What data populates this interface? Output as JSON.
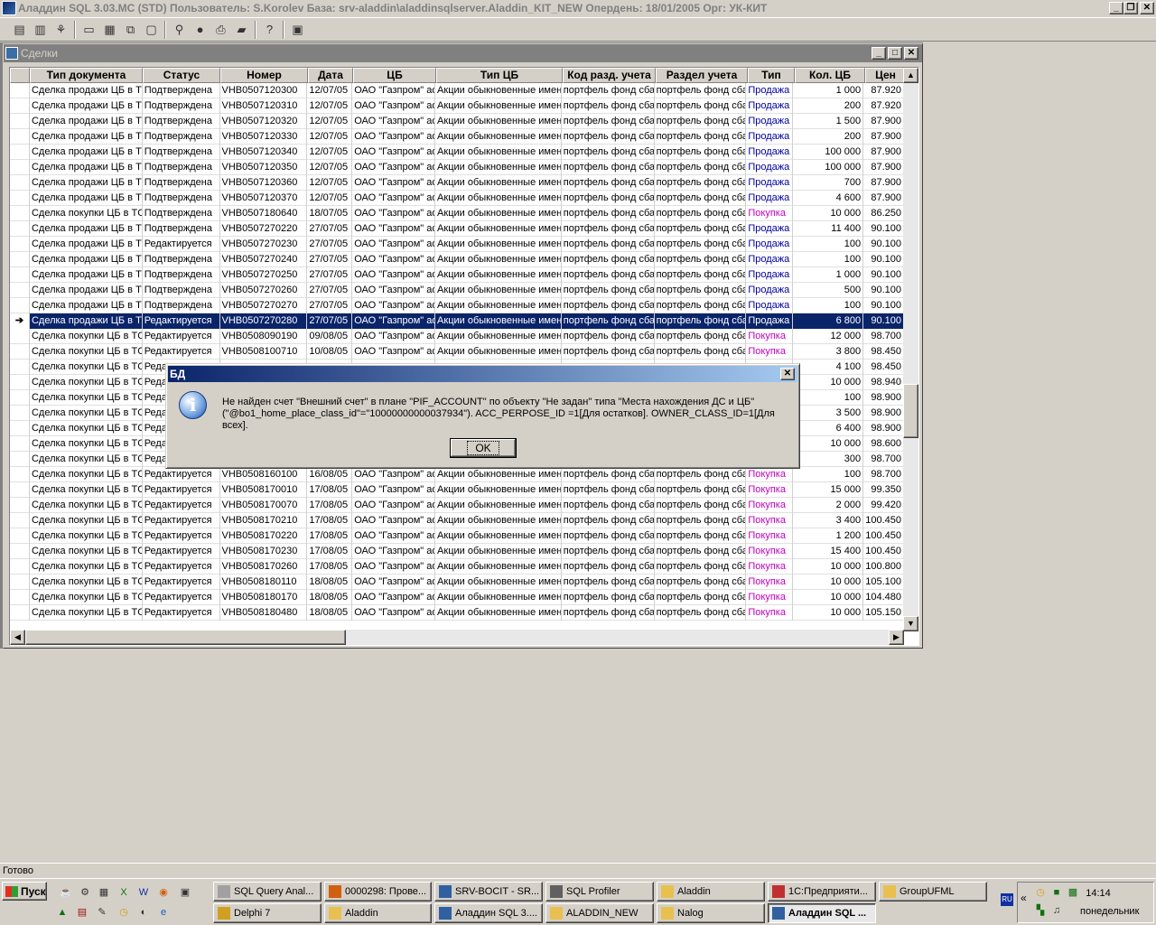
{
  "titlebar": {
    "title": "Аладдин SQL 3.03.MC (STD)  Пользователь: S.Korolev База: srv-aladdin\\aladdinsqlserver.Aladdin_KIT_NEW  Опердень: 18/01/2005  Орг: УК-КИТ"
  },
  "toolbar": {
    "icons": [
      "doc-icon",
      "clipboard-icon",
      "tree-icon",
      "window-icon",
      "tile-icon",
      "cascade-icon",
      "minimize-all-icon",
      "binoculars-icon",
      "stamp-icon",
      "print-icon",
      "folder-up-icon",
      "help-icon",
      "calculator-icon"
    ]
  },
  "child": {
    "title": "Сделки"
  },
  "grid": {
    "columns": [
      "Тип документа",
      "Статус",
      "Номер",
      "Дата",
      "ЦБ",
      "Тип ЦБ",
      "Код разд. учета",
      "Раздел учета",
      "Тип",
      "Кол. ЦБ",
      "Цен"
    ],
    "rows": [
      [
        "Сделка продажи ЦБ в ТП",
        "Подтверждена",
        "VHB0507120300",
        "12/07/05",
        "ОАО \"Газпром\" ао",
        "Акции обыкновенные именные",
        "портфель фонд сбал",
        "портфель фонд сбал",
        "Продажа",
        "1 000",
        "87.920"
      ],
      [
        "Сделка продажи ЦБ в ТП",
        "Подтверждена",
        "VHB0507120310",
        "12/07/05",
        "ОАО \"Газпром\" ао",
        "Акции обыкновенные именные",
        "портфель фонд сбал",
        "портфель фонд сбал",
        "Продажа",
        "200",
        "87.920"
      ],
      [
        "Сделка продажи ЦБ в ТП",
        "Подтверждена",
        "VHB0507120320",
        "12/07/05",
        "ОАО \"Газпром\" ао",
        "Акции обыкновенные именные",
        "портфель фонд сбал",
        "портфель фонд сбал",
        "Продажа",
        "1 500",
        "87.900"
      ],
      [
        "Сделка продажи ЦБ в ТП",
        "Подтверждена",
        "VHB0507120330",
        "12/07/05",
        "ОАО \"Газпром\" ао",
        "Акции обыкновенные именные",
        "портфель фонд сбал",
        "портфель фонд сбал",
        "Продажа",
        "200",
        "87.900"
      ],
      [
        "Сделка продажи ЦБ в ТП",
        "Подтверждена",
        "VHB0507120340",
        "12/07/05",
        "ОАО \"Газпром\" ао",
        "Акции обыкновенные именные",
        "портфель фонд сбал",
        "портфель фонд сбал",
        "Продажа",
        "100 000",
        "87.900"
      ],
      [
        "Сделка продажи ЦБ в ТП",
        "Подтверждена",
        "VHB0507120350",
        "12/07/05",
        "ОАО \"Газпром\" ао",
        "Акции обыкновенные именные",
        "портфель фонд сбал",
        "портфель фонд сбал",
        "Продажа",
        "100 000",
        "87.900"
      ],
      [
        "Сделка продажи ЦБ в ТП",
        "Подтверждена",
        "VHB0507120360",
        "12/07/05",
        "ОАО \"Газпром\" ао",
        "Акции обыкновенные именные",
        "портфель фонд сбал",
        "портфель фонд сбал",
        "Продажа",
        "700",
        "87.900"
      ],
      [
        "Сделка продажи ЦБ в ТП",
        "Подтверждена",
        "VHB0507120370",
        "12/07/05",
        "ОАО \"Газпром\" ао",
        "Акции обыкновенные именные",
        "портфель фонд сбал",
        "портфель фонд сбал",
        "Продажа",
        "4 600",
        "87.900"
      ],
      [
        "Сделка покупки ЦБ в ТС",
        "Подтверждена",
        "VHB0507180640",
        "18/07/05",
        "ОАО \"Газпром\" ао",
        "Акции обыкновенные именные",
        "портфель фонд сбал",
        "портфель фонд сбал",
        "Покупка",
        "10 000",
        "86.250"
      ],
      [
        "Сделка продажи ЦБ в ТП",
        "Подтверждена",
        "VHB0507270220",
        "27/07/05",
        "ОАО \"Газпром\" ао",
        "Акции обыкновенные именные",
        "портфель фонд сбал",
        "портфель фонд сбал",
        "Продажа",
        "11 400",
        "90.100"
      ],
      [
        "Сделка продажи ЦБ в ТП",
        "Редактируется",
        "VHB0507270230",
        "27/07/05",
        "ОАО \"Газпром\" ао",
        "Акции обыкновенные именные",
        "портфель фонд сбал",
        "портфель фонд сбал",
        "Продажа",
        "100",
        "90.100"
      ],
      [
        "Сделка продажи ЦБ в ТП",
        "Подтверждена",
        "VHB0507270240",
        "27/07/05",
        "ОАО \"Газпром\" ао",
        "Акции обыкновенные именные",
        "портфель фонд сбал",
        "портфель фонд сбал",
        "Продажа",
        "100",
        "90.100"
      ],
      [
        "Сделка продажи ЦБ в ТП",
        "Подтверждена",
        "VHB0507270250",
        "27/07/05",
        "ОАО \"Газпром\" ао",
        "Акции обыкновенные именные",
        "портфель фонд сбал",
        "портфель фонд сбал",
        "Продажа",
        "1 000",
        "90.100"
      ],
      [
        "Сделка продажи ЦБ в ТП",
        "Подтверждена",
        "VHB0507270260",
        "27/07/05",
        "ОАО \"Газпром\" ао",
        "Акции обыкновенные именные",
        "портфель фонд сбал",
        "портфель фонд сбал",
        "Продажа",
        "500",
        "90.100"
      ],
      [
        "Сделка продажи ЦБ в ТП",
        "Подтверждена",
        "VHB0507270270",
        "27/07/05",
        "ОАО \"Газпром\" ао",
        "Акции обыкновенные именные",
        "портфель фонд сбал",
        "портфель фонд сбал",
        "Продажа",
        "100",
        "90.100"
      ],
      [
        "Сделка продажи ЦБ в ТП",
        "Редактируется",
        "VHB0507270280",
        "27/07/05",
        "ОАО \"Газпром\" ао",
        "Акции обыкновенные именные",
        "портфель фонд сбал",
        "портфель фонд сбал",
        "Продажа",
        "6 800",
        "90.100"
      ],
      [
        "Сделка покупки ЦБ в ТС",
        "Редактируется",
        "VHB0508090190",
        "09/08/05",
        "ОАО \"Газпром\" ао",
        "Акции обыкновенные именные",
        "портфель фонд сбал",
        "портфель фонд сбал",
        "Покупка",
        "12 000",
        "98.700"
      ],
      [
        "Сделка покупки ЦБ в ТС",
        "Редактируется",
        "VHB0508100710",
        "10/08/05",
        "ОАО \"Газпром\" ао",
        "Акции обыкновенные именные",
        "портфель фонд сбал",
        "портфель фонд сбал",
        "Покупка",
        "3 800",
        "98.450"
      ],
      [
        "Сделка покупки ЦБ в ТС",
        "Редактируется",
        "",
        "",
        "",
        "",
        "",
        "",
        "",
        "4 100",
        "98.450"
      ],
      [
        "Сделка покупки ЦБ в ТС",
        "Редактируется",
        "",
        "",
        "",
        "",
        "",
        "",
        "",
        "10 000",
        "98.940"
      ],
      [
        "Сделка покупки ЦБ в ТС",
        "Редактируется",
        "",
        "",
        "",
        "",
        "",
        "",
        "",
        "100",
        "98.900"
      ],
      [
        "Сделка покупки ЦБ в ТС",
        "Редактируется",
        "",
        "",
        "",
        "",
        "",
        "",
        "",
        "3 500",
        "98.900"
      ],
      [
        "Сделка покупки ЦБ в ТС",
        "Редактируется",
        "",
        "",
        "",
        "",
        "",
        "",
        "",
        "6 400",
        "98.900"
      ],
      [
        "Сделка покупки ЦБ в ТС",
        "Редактируется",
        "",
        "",
        "",
        "",
        "",
        "",
        "",
        "10 000",
        "98.600"
      ],
      [
        "Сделка покупки ЦБ в ТС",
        "Редактируется",
        "",
        "",
        "",
        "",
        "",
        "",
        "",
        "300",
        "98.700"
      ],
      [
        "Сделка покупки ЦБ в ТС",
        "Редактируется",
        "VHB0508160100",
        "16/08/05",
        "ОАО \"Газпром\" ао",
        "Акции обыкновенные именные",
        "портфель фонд сбал",
        "портфель фонд сбал",
        "Покупка",
        "100",
        "98.700"
      ],
      [
        "Сделка покупки ЦБ в ТС",
        "Редактируется",
        "VHB0508170010",
        "17/08/05",
        "ОАО \"Газпром\" ао",
        "Акции обыкновенные именные",
        "портфель фонд сбал",
        "портфель фонд сбал",
        "Покупка",
        "15 000",
        "99.350"
      ],
      [
        "Сделка покупки ЦБ в ТС",
        "Редактируется",
        "VHB0508170070",
        "17/08/05",
        "ОАО \"Газпром\" ао",
        "Акции обыкновенные именные",
        "портфель фонд сбал",
        "портфель фонд сбал",
        "Покупка",
        "2 000",
        "99.420"
      ],
      [
        "Сделка покупки ЦБ в ТС",
        "Редактируется",
        "VHB0508170210",
        "17/08/05",
        "ОАО \"Газпром\" ао",
        "Акции обыкновенные именные",
        "портфель фонд сбал",
        "портфель фонд сбал",
        "Покупка",
        "3 400",
        "100.450"
      ],
      [
        "Сделка покупки ЦБ в ТС",
        "Редактируется",
        "VHB0508170220",
        "17/08/05",
        "ОАО \"Газпром\" ао",
        "Акции обыкновенные именные",
        "портфель фонд сбал",
        "портфель фонд сбал",
        "Покупка",
        "1 200",
        "100.450"
      ],
      [
        "Сделка покупки ЦБ в ТС",
        "Редактируется",
        "VHB0508170230",
        "17/08/05",
        "ОАО \"Газпром\" ао",
        "Акции обыкновенные именные",
        "портфель фонд сбал",
        "портфель фонд сбал",
        "Покупка",
        "15 400",
        "100.450"
      ],
      [
        "Сделка покупки ЦБ в ТС",
        "Редактируется",
        "VHB0508170260",
        "17/08/05",
        "ОАО \"Газпром\" ао",
        "Акции обыкновенные именные",
        "портфель фонд сбал",
        "портфель фонд сбал",
        "Покупка",
        "10 000",
        "100.800"
      ],
      [
        "Сделка покупки ЦБ в ТС",
        "Редактируется",
        "VHB0508180110",
        "18/08/05",
        "ОАО \"Газпром\" ао",
        "Акции обыкновенные именные",
        "портфель фонд сбал",
        "портфель фонд сбал",
        "Покупка",
        "10 000",
        "105.100"
      ],
      [
        "Сделка покупки ЦБ в ТС",
        "Редактируется",
        "VHB0508180170",
        "18/08/05",
        "ОАО \"Газпром\" ао",
        "Акции обыкновенные именные",
        "портфель фонд сбал",
        "портфель фонд сбал",
        "Покупка",
        "10 000",
        "104.480"
      ],
      [
        "Сделка покупки ЦБ в ТС",
        "Редактируется",
        "VHB0508180480",
        "18/08/05",
        "ОАО \"Газпром\" ао",
        "Акции обыкновенные именные",
        "портфель фонд сбал",
        "портфель фонд сбал",
        "Покупка",
        "10 000",
        "105.150"
      ]
    ],
    "selected_row": 15,
    "row_indicator": "➔"
  },
  "dialog": {
    "title": "БД",
    "message_line1": "Не найден счет \"Внешний счет\" в плане \"PIF_ACCOUNT\" по объекту \"Не задан\" типа \"Места нахождения ДС и ЦБ\"",
    "message_line2": "(\"@bo1_home_place_class_id\"=\"10000000000037934\"). ACC_PERPOSE_ID =1[Для остатков]. OWNER_CLASS_ID=1[Для всех].",
    "ok_label": "OK"
  },
  "statusbar": {
    "text": "Готово"
  },
  "taskbar": {
    "start_label": "Пуск",
    "row1": [
      "SQL Query Anal...",
      "0000298: Прове...",
      "SRV-BOCIT - SR...",
      "SQL Profiler",
      "Aladdin",
      "1С:Предприяти...",
      "GroupUFML"
    ],
    "row2": [
      "Delphi 7",
      "Aladdin",
      "Аладдин SQL 3....",
      "ALADDIN_NEW",
      "Nalog",
      "Аладдин SQL ..."
    ],
    "lang": "RU",
    "time": "14:14",
    "day": "понедельник"
  },
  "colors": {
    "selection": "#0a246a",
    "sell": "#0000a0",
    "buy": "#c000c0",
    "window": "#d4d0c8"
  }
}
